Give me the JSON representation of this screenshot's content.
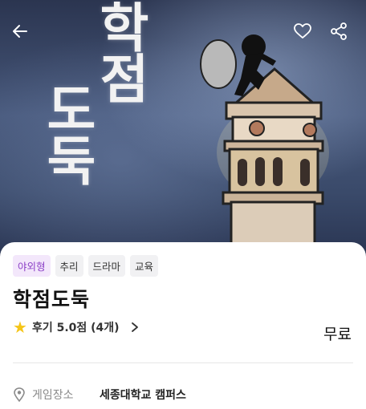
{
  "hero": {
    "title_art_line1": "학점",
    "title_art_line2": "도둑"
  },
  "nav": {
    "back_icon": "arrow-left-icon",
    "favorite_icon": "heart-icon",
    "share_icon": "share-icon"
  },
  "tags": [
    "야외형",
    "추리",
    "드라마",
    "교육"
  ],
  "game": {
    "title": "학점도둑",
    "review_summary": "후기 5.0점 (4개)",
    "rating": 5.0,
    "review_count": 4,
    "price": "무료"
  },
  "location": {
    "label": "게임장소",
    "value": "세종대학교 캠퍼스"
  },
  "colors": {
    "tag_primary_bg": "#f3e7fb",
    "tag_primary_text": "#8b3fc6",
    "star": "#f5c518"
  }
}
